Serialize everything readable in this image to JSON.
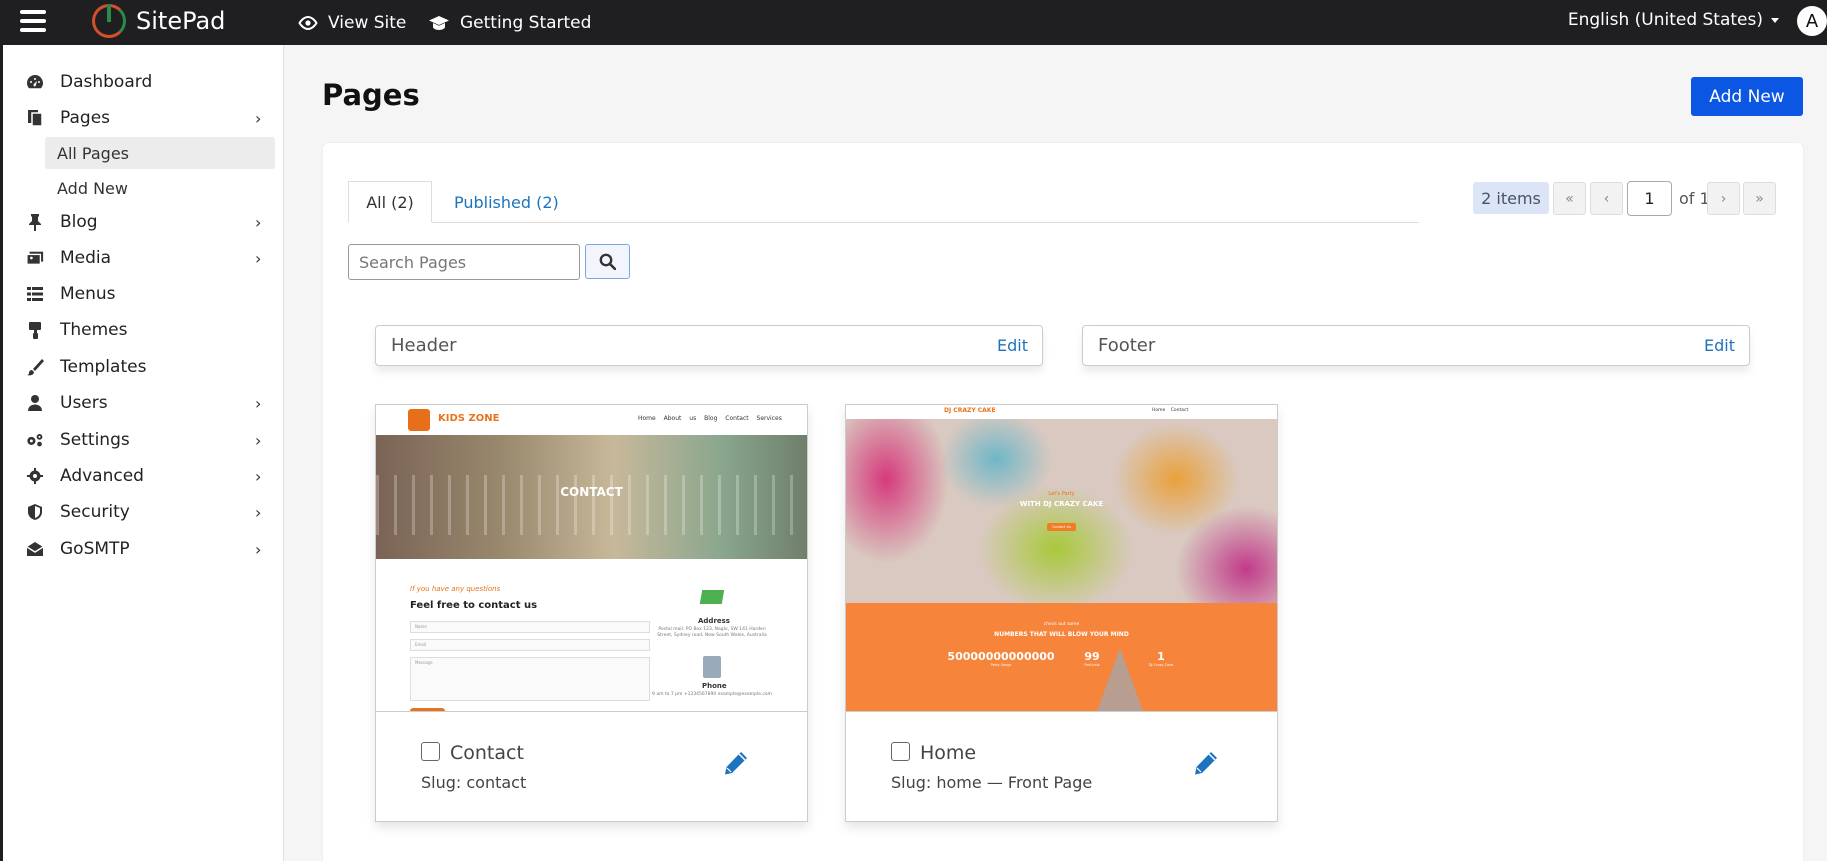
{
  "app": {
    "name": "SitePad",
    "avatar_letter": "A",
    "language": "English (United States)",
    "top_nav": [
      {
        "label": "View Site",
        "icon": "eye-icon"
      },
      {
        "label": "Getting Started",
        "icon": "graduation-cap-icon"
      }
    ]
  },
  "sidebar": {
    "items": [
      {
        "label": "Dashboard",
        "icon": "dashboard-icon",
        "has_children": false
      },
      {
        "label": "Pages",
        "icon": "pages-icon",
        "has_children": true
      },
      {
        "label": "Blog",
        "icon": "pin-icon",
        "has_children": true
      },
      {
        "label": "Media",
        "icon": "media-icon",
        "has_children": true
      },
      {
        "label": "Menus",
        "icon": "list-icon",
        "has_children": false
      },
      {
        "label": "Themes",
        "icon": "paint-roller-icon",
        "has_children": false
      },
      {
        "label": "Templates",
        "icon": "brush-icon",
        "has_children": false
      },
      {
        "label": "Users",
        "icon": "user-icon",
        "has_children": true
      },
      {
        "label": "Settings",
        "icon": "cogs-icon",
        "has_children": true
      },
      {
        "label": "Advanced",
        "icon": "gear-icon",
        "has_children": true
      },
      {
        "label": "Security",
        "icon": "shield-icon",
        "has_children": true
      },
      {
        "label": "GoSMTP",
        "icon": "envelope-open-icon",
        "has_children": true
      }
    ],
    "pages_submenu": [
      "All Pages",
      "Add New"
    ]
  },
  "main": {
    "title": "Pages",
    "add_new_label": "Add New",
    "tabs": [
      {
        "label": "All (2)",
        "active": true
      },
      {
        "label": "Published (2)",
        "active": false
      }
    ],
    "pagination": {
      "count": "2 items",
      "first": "«",
      "prev": "‹",
      "current": "1",
      "of": "of 1",
      "next": "›",
      "last": "»"
    },
    "search": {
      "placeholder": "Search Pages",
      "value": ""
    },
    "header_box": {
      "title": "Header",
      "edit_label": "Edit"
    },
    "footer_box": {
      "title": "Footer",
      "edit_label": "Edit"
    },
    "cards": [
      {
        "title": "Contact",
        "slug": "Slug: contact",
        "preview": {
          "brand": "KIDS ZONE",
          "links": "Home About us Blog Contact Services",
          "hero": "CONTACT",
          "question": "If you have any questions",
          "heading": "Feel free to contact us",
          "fields": [
            "Name",
            "Email",
            "Message"
          ],
          "address_title": "Address",
          "address_text": "Postal mail: PO Box 123, Naglo, SW 141 Harden Street, Sydney road, New South Wales, Australia",
          "phone_title": "Phone",
          "phone_text": "9 am to 7 pm +1234567890 example@example.com"
        }
      },
      {
        "title": "Home",
        "slug": "Slug: home — Front Page",
        "preview": {
          "brand": "DJ CRAZY CAKE",
          "links": "Home Contact",
          "hero_sub": "Let's Party",
          "hero_title": "WITH DJ CRAZY CAKE",
          "hero_button": "Contact Us",
          "section_sub": "check out some",
          "section_title": "NUMBERS THAT WILL BLOW YOUR MIND",
          "stats": [
            {
              "value": "50000000000000",
              "label": "Party Songs"
            },
            {
              "value": "99",
              "label": "Festivals"
            },
            {
              "value": "1",
              "label": "DJ Crazy Cake"
            }
          ]
        }
      }
    ]
  },
  "colors": {
    "accent": "#0b57e3",
    "link": "#1e73be",
    "topbar": "#1f1f22"
  }
}
